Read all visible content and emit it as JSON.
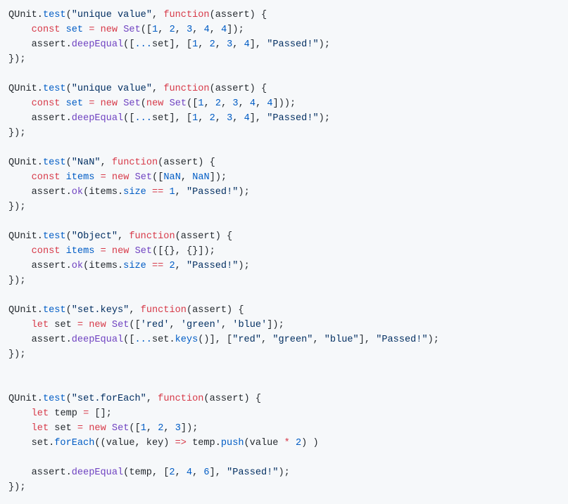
{
  "code_block": {
    "language": "javascript",
    "colors": {
      "background": "#f6f8fa",
      "plain": "#24292e",
      "keyword": "#d73a49",
      "function": "#6f42c1",
      "property": "#005cc5",
      "number": "#005cc5",
      "string": "#032f62"
    },
    "lines": [
      [
        [
          "plain",
          "QUnit."
        ],
        [
          "prop",
          "test"
        ],
        [
          "plain",
          "("
        ],
        [
          "str",
          "\"unique value\""
        ],
        [
          "plain",
          ", "
        ],
        [
          "kw",
          "function"
        ],
        [
          "plain",
          "(assert) {"
        ]
      ],
      [
        [
          "plain",
          "    "
        ],
        [
          "kw",
          "const"
        ],
        [
          "plain",
          " "
        ],
        [
          "prop",
          "set"
        ],
        [
          "plain",
          " "
        ],
        [
          "op",
          "="
        ],
        [
          "plain",
          " "
        ],
        [
          "kw",
          "new"
        ],
        [
          "plain",
          " "
        ],
        [
          "fn",
          "Set"
        ],
        [
          "plain",
          "(["
        ],
        [
          "num",
          "1"
        ],
        [
          "plain",
          ", "
        ],
        [
          "num",
          "2"
        ],
        [
          "plain",
          ", "
        ],
        [
          "num",
          "3"
        ],
        [
          "plain",
          ", "
        ],
        [
          "num",
          "4"
        ],
        [
          "plain",
          ", "
        ],
        [
          "num",
          "4"
        ],
        [
          "plain",
          "]);"
        ]
      ],
      [
        [
          "plain",
          "    assert."
        ],
        [
          "fn",
          "deepEqual"
        ],
        [
          "plain",
          "(["
        ],
        [
          "prop",
          "..."
        ],
        [
          "plain",
          "set], ["
        ],
        [
          "num",
          "1"
        ],
        [
          "plain",
          ", "
        ],
        [
          "num",
          "2"
        ],
        [
          "plain",
          ", "
        ],
        [
          "num",
          "3"
        ],
        [
          "plain",
          ", "
        ],
        [
          "num",
          "4"
        ],
        [
          "plain",
          "], "
        ],
        [
          "str",
          "\"Passed!\""
        ],
        [
          "plain",
          ");"
        ]
      ],
      [
        [
          "plain",
          "});"
        ]
      ],
      [
        [
          "plain",
          ""
        ]
      ],
      [
        [
          "plain",
          "QUnit."
        ],
        [
          "prop",
          "test"
        ],
        [
          "plain",
          "("
        ],
        [
          "str",
          "\"unique value\""
        ],
        [
          "plain",
          ", "
        ],
        [
          "kw",
          "function"
        ],
        [
          "plain",
          "(assert) {"
        ]
      ],
      [
        [
          "plain",
          "    "
        ],
        [
          "kw",
          "const"
        ],
        [
          "plain",
          " "
        ],
        [
          "prop",
          "set"
        ],
        [
          "plain",
          " "
        ],
        [
          "op",
          "="
        ],
        [
          "plain",
          " "
        ],
        [
          "kw",
          "new"
        ],
        [
          "plain",
          " "
        ],
        [
          "fn",
          "Set"
        ],
        [
          "plain",
          "("
        ],
        [
          "kw",
          "new"
        ],
        [
          "plain",
          " "
        ],
        [
          "fn",
          "Set"
        ],
        [
          "plain",
          "(["
        ],
        [
          "num",
          "1"
        ],
        [
          "plain",
          ", "
        ],
        [
          "num",
          "2"
        ],
        [
          "plain",
          ", "
        ],
        [
          "num",
          "3"
        ],
        [
          "plain",
          ", "
        ],
        [
          "num",
          "4"
        ],
        [
          "plain",
          ", "
        ],
        [
          "num",
          "4"
        ],
        [
          "plain",
          "]));"
        ]
      ],
      [
        [
          "plain",
          "    assert."
        ],
        [
          "fn",
          "deepEqual"
        ],
        [
          "plain",
          "(["
        ],
        [
          "prop",
          "..."
        ],
        [
          "plain",
          "set], ["
        ],
        [
          "num",
          "1"
        ],
        [
          "plain",
          ", "
        ],
        [
          "num",
          "2"
        ],
        [
          "plain",
          ", "
        ],
        [
          "num",
          "3"
        ],
        [
          "plain",
          ", "
        ],
        [
          "num",
          "4"
        ],
        [
          "plain",
          "], "
        ],
        [
          "str",
          "\"Passed!\""
        ],
        [
          "plain",
          ");"
        ]
      ],
      [
        [
          "plain",
          "});"
        ]
      ],
      [
        [
          "plain",
          ""
        ]
      ],
      [
        [
          "plain",
          "QUnit."
        ],
        [
          "prop",
          "test"
        ],
        [
          "plain",
          "("
        ],
        [
          "str",
          "\"NaN\""
        ],
        [
          "plain",
          ", "
        ],
        [
          "kw",
          "function"
        ],
        [
          "plain",
          "(assert) {"
        ]
      ],
      [
        [
          "plain",
          "    "
        ],
        [
          "kw",
          "const"
        ],
        [
          "plain",
          " "
        ],
        [
          "prop",
          "items"
        ],
        [
          "plain",
          " "
        ],
        [
          "op",
          "="
        ],
        [
          "plain",
          " "
        ],
        [
          "kw",
          "new"
        ],
        [
          "plain",
          " "
        ],
        [
          "fn",
          "Set"
        ],
        [
          "plain",
          "(["
        ],
        [
          "num",
          "NaN"
        ],
        [
          "plain",
          ", "
        ],
        [
          "num",
          "NaN"
        ],
        [
          "plain",
          "]);"
        ]
      ],
      [
        [
          "plain",
          "    assert."
        ],
        [
          "fn",
          "ok"
        ],
        [
          "plain",
          "(items."
        ],
        [
          "prop",
          "size"
        ],
        [
          "plain",
          " "
        ],
        [
          "op",
          "=="
        ],
        [
          "plain",
          " "
        ],
        [
          "num",
          "1"
        ],
        [
          "plain",
          ", "
        ],
        [
          "str",
          "\"Passed!\""
        ],
        [
          "plain",
          ");"
        ]
      ],
      [
        [
          "plain",
          "});"
        ]
      ],
      [
        [
          "plain",
          ""
        ]
      ],
      [
        [
          "plain",
          "QUnit."
        ],
        [
          "prop",
          "test"
        ],
        [
          "plain",
          "("
        ],
        [
          "str",
          "\"Object\""
        ],
        [
          "plain",
          ", "
        ],
        [
          "kw",
          "function"
        ],
        [
          "plain",
          "(assert) {"
        ]
      ],
      [
        [
          "plain",
          "    "
        ],
        [
          "kw",
          "const"
        ],
        [
          "plain",
          " "
        ],
        [
          "prop",
          "items"
        ],
        [
          "plain",
          " "
        ],
        [
          "op",
          "="
        ],
        [
          "plain",
          " "
        ],
        [
          "kw",
          "new"
        ],
        [
          "plain",
          " "
        ],
        [
          "fn",
          "Set"
        ],
        [
          "plain",
          "([{}, {}]);"
        ]
      ],
      [
        [
          "plain",
          "    assert."
        ],
        [
          "fn",
          "ok"
        ],
        [
          "plain",
          "(items."
        ],
        [
          "prop",
          "size"
        ],
        [
          "plain",
          " "
        ],
        [
          "op",
          "=="
        ],
        [
          "plain",
          " "
        ],
        [
          "num",
          "2"
        ],
        [
          "plain",
          ", "
        ],
        [
          "str",
          "\"Passed!\""
        ],
        [
          "plain",
          ");"
        ]
      ],
      [
        [
          "plain",
          "});"
        ]
      ],
      [
        [
          "plain",
          ""
        ]
      ],
      [
        [
          "plain",
          "QUnit."
        ],
        [
          "prop",
          "test"
        ],
        [
          "plain",
          "("
        ],
        [
          "str",
          "\"set.keys\""
        ],
        [
          "plain",
          ", "
        ],
        [
          "kw",
          "function"
        ],
        [
          "plain",
          "(assert) {"
        ]
      ],
      [
        [
          "plain",
          "    "
        ],
        [
          "kw",
          "let"
        ],
        [
          "plain",
          " set "
        ],
        [
          "op",
          "="
        ],
        [
          "plain",
          " "
        ],
        [
          "kw",
          "new"
        ],
        [
          "plain",
          " "
        ],
        [
          "fn",
          "Set"
        ],
        [
          "plain",
          "(["
        ],
        [
          "str",
          "'red'"
        ],
        [
          "plain",
          ", "
        ],
        [
          "str",
          "'green'"
        ],
        [
          "plain",
          ", "
        ],
        [
          "str",
          "'blue'"
        ],
        [
          "plain",
          "]);"
        ]
      ],
      [
        [
          "plain",
          "    assert."
        ],
        [
          "fn",
          "deepEqual"
        ],
        [
          "plain",
          "(["
        ],
        [
          "prop",
          "..."
        ],
        [
          "plain",
          "set."
        ],
        [
          "prop",
          "keys"
        ],
        [
          "plain",
          "()], ["
        ],
        [
          "str",
          "\"red\""
        ],
        [
          "plain",
          ", "
        ],
        [
          "str",
          "\"green\""
        ],
        [
          "plain",
          ", "
        ],
        [
          "str",
          "\"blue\""
        ],
        [
          "plain",
          "], "
        ],
        [
          "str",
          "\"Passed!\""
        ],
        [
          "plain",
          ");"
        ]
      ],
      [
        [
          "plain",
          "});"
        ]
      ],
      [
        [
          "plain",
          ""
        ]
      ],
      [
        [
          "plain",
          ""
        ]
      ],
      [
        [
          "plain",
          "QUnit."
        ],
        [
          "prop",
          "test"
        ],
        [
          "plain",
          "("
        ],
        [
          "str",
          "\"set.forEach\""
        ],
        [
          "plain",
          ", "
        ],
        [
          "kw",
          "function"
        ],
        [
          "plain",
          "(assert) {"
        ]
      ],
      [
        [
          "plain",
          "    "
        ],
        [
          "kw",
          "let"
        ],
        [
          "plain",
          " temp "
        ],
        [
          "op",
          "="
        ],
        [
          "plain",
          " [];"
        ]
      ],
      [
        [
          "plain",
          "    "
        ],
        [
          "kw",
          "let"
        ],
        [
          "plain",
          " set "
        ],
        [
          "op",
          "="
        ],
        [
          "plain",
          " "
        ],
        [
          "kw",
          "new"
        ],
        [
          "plain",
          " "
        ],
        [
          "fn",
          "Set"
        ],
        [
          "plain",
          "(["
        ],
        [
          "num",
          "1"
        ],
        [
          "plain",
          ", "
        ],
        [
          "num",
          "2"
        ],
        [
          "plain",
          ", "
        ],
        [
          "num",
          "3"
        ],
        [
          "plain",
          "]);"
        ]
      ],
      [
        [
          "plain",
          "    set."
        ],
        [
          "prop",
          "forEach"
        ],
        [
          "plain",
          "((value, key) "
        ],
        [
          "op",
          "=>"
        ],
        [
          "plain",
          " temp."
        ],
        [
          "prop",
          "push"
        ],
        [
          "plain",
          "(value "
        ],
        [
          "op",
          "*"
        ],
        [
          "plain",
          " "
        ],
        [
          "num",
          "2"
        ],
        [
          "plain",
          ") )"
        ]
      ],
      [
        [
          "plain",
          ""
        ]
      ],
      [
        [
          "plain",
          "    assert."
        ],
        [
          "fn",
          "deepEqual"
        ],
        [
          "plain",
          "(temp, ["
        ],
        [
          "num",
          "2"
        ],
        [
          "plain",
          ", "
        ],
        [
          "num",
          "4"
        ],
        [
          "plain",
          ", "
        ],
        [
          "num",
          "6"
        ],
        [
          "plain",
          "], "
        ],
        [
          "str",
          "\"Passed!\""
        ],
        [
          "plain",
          ");"
        ]
      ],
      [
        [
          "plain",
          "});"
        ]
      ]
    ]
  }
}
